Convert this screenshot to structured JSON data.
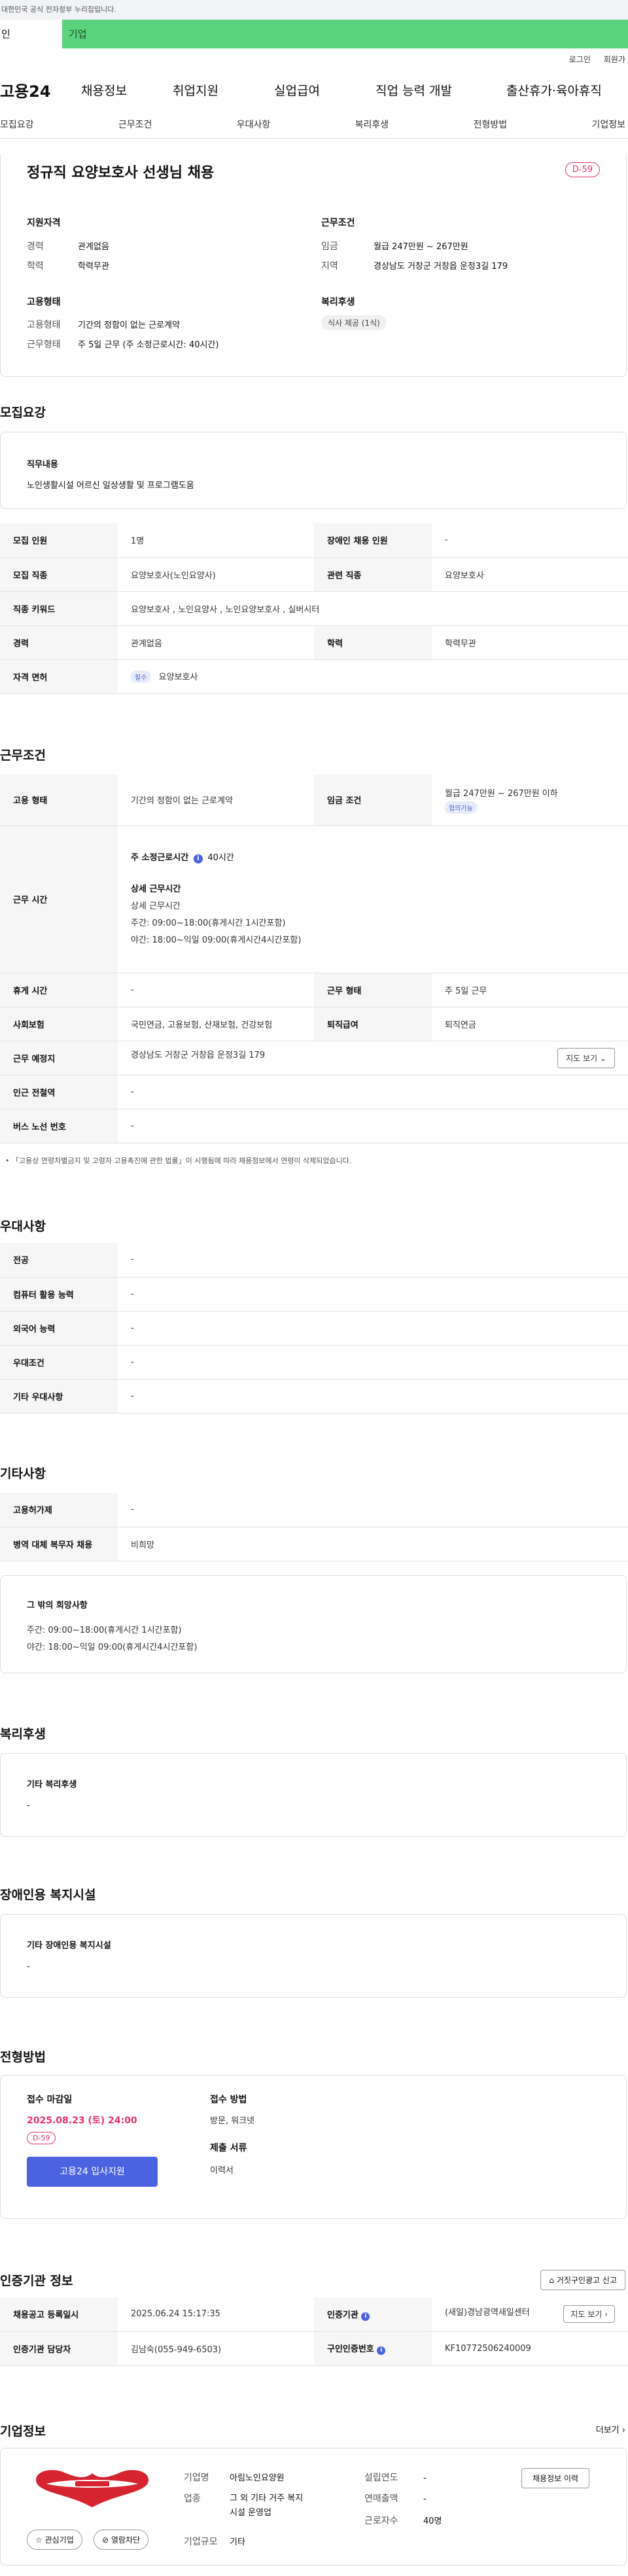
{
  "gov_notice": "대한민국 공식 전자정부 누리집입니다.",
  "tabs": {
    "personal": "인",
    "company": "기업"
  },
  "util": [
    "로그인",
    "회원가"
  ],
  "gnb": {
    "logo": "고용24",
    "items": [
      "채용정보",
      "취업지원",
      "실업급여",
      "직업 능력 개발",
      "출산휴가·육아휴직"
    ]
  },
  "subnav": [
    "모집요강",
    "근무조건",
    "우대사항",
    "복리후생",
    "전형방법",
    "기업정보"
  ],
  "summary": {
    "title": "정규직 요양보호사 선생님 채용",
    "dday": "D-59",
    "qual_title": "지원자격",
    "qual": [
      {
        "k": "경력",
        "v": "관계없음"
      },
      {
        "k": "학력",
        "v": "학력무관"
      }
    ],
    "emp_title": "고용형태",
    "emp": [
      {
        "k": "고용형태",
        "v": "기간의 정함이 없는 근로계약"
      },
      {
        "k": "근무형태",
        "v": "주 5일 근무 (주 소정근로시간: 40시간)"
      }
    ],
    "work_title": "근무조건",
    "work": [
      {
        "k": "임금",
        "v": "월급 247만원 ~ 267만원"
      },
      {
        "k": "지역",
        "v": "경상남도 거창군 거창읍 운정3길 179"
      }
    ],
    "welfare_title": "복리후생",
    "welfare_tag": "식사 제공 (1식)"
  },
  "recruit": {
    "heading": "모집요강",
    "duty_label": "직무내용",
    "duty_text": "노인생활시설 어르신  일상생활 및 프로그램도움",
    "rows": [
      {
        "k1": "모집 인원",
        "v1": "1명",
        "k2": "장애인 채용 인원",
        "v2": "-"
      },
      {
        "k1": "모집 직종",
        "v1": "요양보호사(노인요양사)",
        "k2": "관련 직종",
        "v2": "요양보호사"
      },
      {
        "k1": "직종 키워드",
        "v1": "요양보호사 , 노인요양사 , 노인요양보호사 , 실버시터",
        "k2": "",
        "v2": ""
      },
      {
        "k1": "경력",
        "v1": "관계없음",
        "k2": "학력",
        "v2": "학력무관"
      }
    ],
    "license_label": "자격 면허",
    "license_badge": "필수",
    "license_value": "요양보호사"
  },
  "conditions": {
    "heading": "근무조건",
    "emp_type_label": "고용 형태",
    "emp_type": "기간의 정함이 없는 근로계약",
    "wage_label": "임금 조건",
    "wage": "월급 247만원 ~ 267만원 이하",
    "wage_badge": "협의가능",
    "hours_label": "근무 시간",
    "hours_week": "주 소정근로시간",
    "hours_week_value": "40시간",
    "hours_detail_title": "상세 근무시간",
    "hours_lines": [
      "상세 근무시간",
      "주간: 09:00~18:00(휴게시간 1시간포함)",
      "야간: 18:00~익일 09:00(휴게시간4시간포함)"
    ],
    "rest_label": "휴게 시간",
    "rest": "-",
    "work_form_label": "근무 형태",
    "work_form": "주 5일 근무",
    "insurance_label": "사회보험",
    "insurance": "국민연금, 고용보험, 산재보험, 건강보험",
    "retire_label": "퇴직급여",
    "retire": "퇴직연금",
    "place_label": "근무 예정지",
    "place": "경상남도 거창군 거창읍 운정3길 179",
    "map_btn": "지도 보기",
    "subway_label": "인근 전철역",
    "subway": "-",
    "bus_label": "버스 노선 번호",
    "bus": "-",
    "notice": "「고용상 연령차별금지 및 고령자 고용촉진에 관한 법률」이 시행됨에 따라 채용정보에서 연령이 삭제되었습니다."
  },
  "preference": {
    "heading": "우대사항",
    "rows": [
      {
        "k": "전공",
        "v": "-"
      },
      {
        "k": "컴퓨터 활용 능력",
        "v": "-"
      },
      {
        "k": "외국어 능력",
        "v": "-"
      },
      {
        "k": "우대조건",
        "v": "-"
      },
      {
        "k": "기타 우대사항",
        "v": "-"
      }
    ]
  },
  "etc": {
    "heading": "기타사항",
    "rows": [
      {
        "k": "고용허가제",
        "v": "-"
      },
      {
        "k": "병역 대체 복무자 채용",
        "v": "비희망"
      }
    ],
    "box_title": "그 밖의 희망사항",
    "box_lines": [
      "주간: 09:00~18:00(휴게시간 1시간포함)",
      "야간: 18:00~익일 09:00(휴게시간4시간포함)"
    ]
  },
  "welfare": {
    "heading": "복리후생",
    "box_title": "기타 복리후생",
    "box_value": "-"
  },
  "disability": {
    "heading": "장애인용 복지시설",
    "box_title": "기타 장애인용 복지시설",
    "box_value": "-"
  },
  "process": {
    "heading": "전형방법",
    "deadline_label": "접수 마감일",
    "deadline": "2025.08.23 (토) 24:00",
    "dday": "D-59",
    "apply_btn": "고용24 입사지원",
    "method_label": "접수 방법",
    "method": "방문, 워크넷",
    "docs_label": "제출 서류",
    "docs": "이력서"
  },
  "cert": {
    "heading": "인증기관 정보",
    "report_btn": "거짓구인광고 신고",
    "rows": [
      {
        "k1": "채용공고 등록일시",
        "v1": "2025.06.24 15:17:35",
        "k2": "인증기관",
        "v2": "(새일)경남광역새일센터"
      },
      {
        "k1": "인증기관 담당자",
        "v1": "김남숙(055-949-6503)",
        "k2": "구인인증번호",
        "v2": "KF10772506240009"
      }
    ],
    "map_btn": "지도 보기"
  },
  "company": {
    "heading": "기업정보",
    "more": "더보기",
    "fav_btn": "관심기업",
    "block_btn": "열람차단",
    "fields": [
      {
        "k": "기업명",
        "v": "아림노인요양원"
      },
      {
        "k": "업종",
        "v": "그 외 기타 거주 복지시설 운영업"
      },
      {
        "k": "기업규모",
        "v": "기타"
      }
    ],
    "fields2": [
      {
        "k": "설립연도",
        "v": "-"
      },
      {
        "k": "연매출액",
        "v": "-"
      },
      {
        "k": "근로자수",
        "v": "40명"
      }
    ],
    "history_btn": "채용정보 이력"
  },
  "colors": {
    "brand_green": "#5ad47c",
    "accent_pink": "#e3336a",
    "apply_blue": "#4b63e0"
  }
}
